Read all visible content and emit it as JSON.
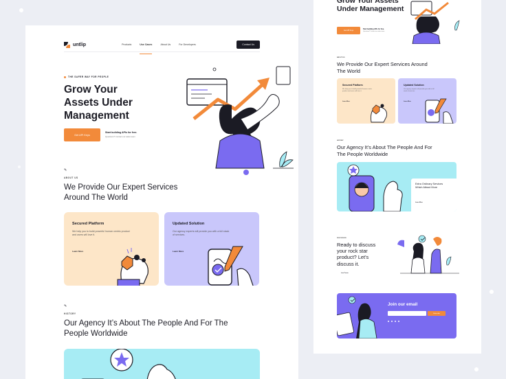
{
  "brand": {
    "name": "untlip",
    "accent": "#f28a3a",
    "dark": "#1b1b24",
    "peach": "#fde6c8",
    "lavender": "#c9c7fb",
    "teal": "#a7ecf4",
    "purple": "#7a6bf0"
  },
  "nav": {
    "items": [
      "Products",
      "Use Cases",
      "About Us",
      "For Developers"
    ],
    "active": "Use Cases",
    "cta": "Contact Us"
  },
  "hero": {
    "eyebrow": "THE SAFER WAY FOR PEOPLE",
    "title": "Grow Your Assets Under Management",
    "button": "Get API Keys",
    "note": "Start building APIs for free.",
    "sub_note": "Questions? Contact our sales team"
  },
  "about": {
    "label": "ABOUT US",
    "title": "We Provide Our Expert Services Around The World",
    "cards": [
      {
        "title": "Secured Platform",
        "text": "We help you to build powerful human centric product and users will love it.",
        "link": "Learn More"
      },
      {
        "title": "Updated Solution",
        "text": "Our agency experts will provide you with a full stack of services.",
        "link": "Learn More"
      }
    ]
  },
  "history": {
    "label": "HISTORY",
    "title": "Our Agency It’s About The People And For The People Worldwide"
  },
  "right": {
    "hero_title": "Grow Your Assets Under Management",
    "button": "Get API Keys",
    "note": "Start building APIs for free.",
    "sub_note": "Questions? Contact our sales team",
    "about_label": "ABOUT US",
    "about_title": "We Provide Our Expert Services Around The World",
    "cards": [
      {
        "title": "Secured Platform",
        "text": "We help you to build powerful human centric product and users will love it.",
        "link": "Learn More"
      },
      {
        "title": "Updated Solution",
        "text": "Our agency experts will provide you with a full stack of services.",
        "link": "Learn More"
      }
    ],
    "history_label": "HISTORY",
    "history_title": "Our Agency It’s About The People And For The People Worldwide",
    "services_text": "Extra Ordinary Services Which Attract More",
    "services_link": "Learn More",
    "ready_label": "DISCUSSION",
    "ready_text": "Ready to discuss your rock star product? Let's discuss it.",
    "ready_link": "Lets Points",
    "join_title": "Join our email",
    "subscribe": "Subscribe"
  }
}
